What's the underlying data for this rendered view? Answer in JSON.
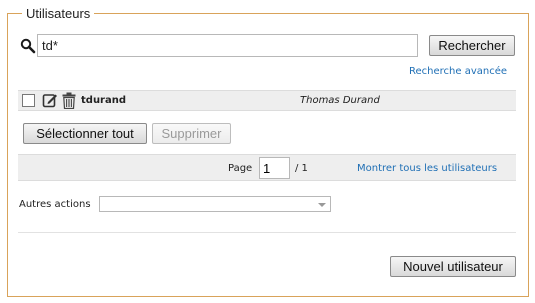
{
  "panel": {
    "legend": "Utilisateurs"
  },
  "search": {
    "value": "td*",
    "button_label": "Rechercher",
    "advanced_link": "Recherche avancée"
  },
  "results": [
    {
      "username": "tdurand",
      "full_name": "Thomas Durand"
    }
  ],
  "selection": {
    "select_all_label": "Sélectionner tout",
    "delete_label": "Supprimer"
  },
  "pagination": {
    "page_label": "Page",
    "current_page": "1",
    "total": "/ 1",
    "show_all_link": "Montrer tous les utilisateurs"
  },
  "other_actions": {
    "label": "Autres actions",
    "selected": ""
  },
  "footer": {
    "new_user_label": "Nouvel utilisateur"
  }
}
